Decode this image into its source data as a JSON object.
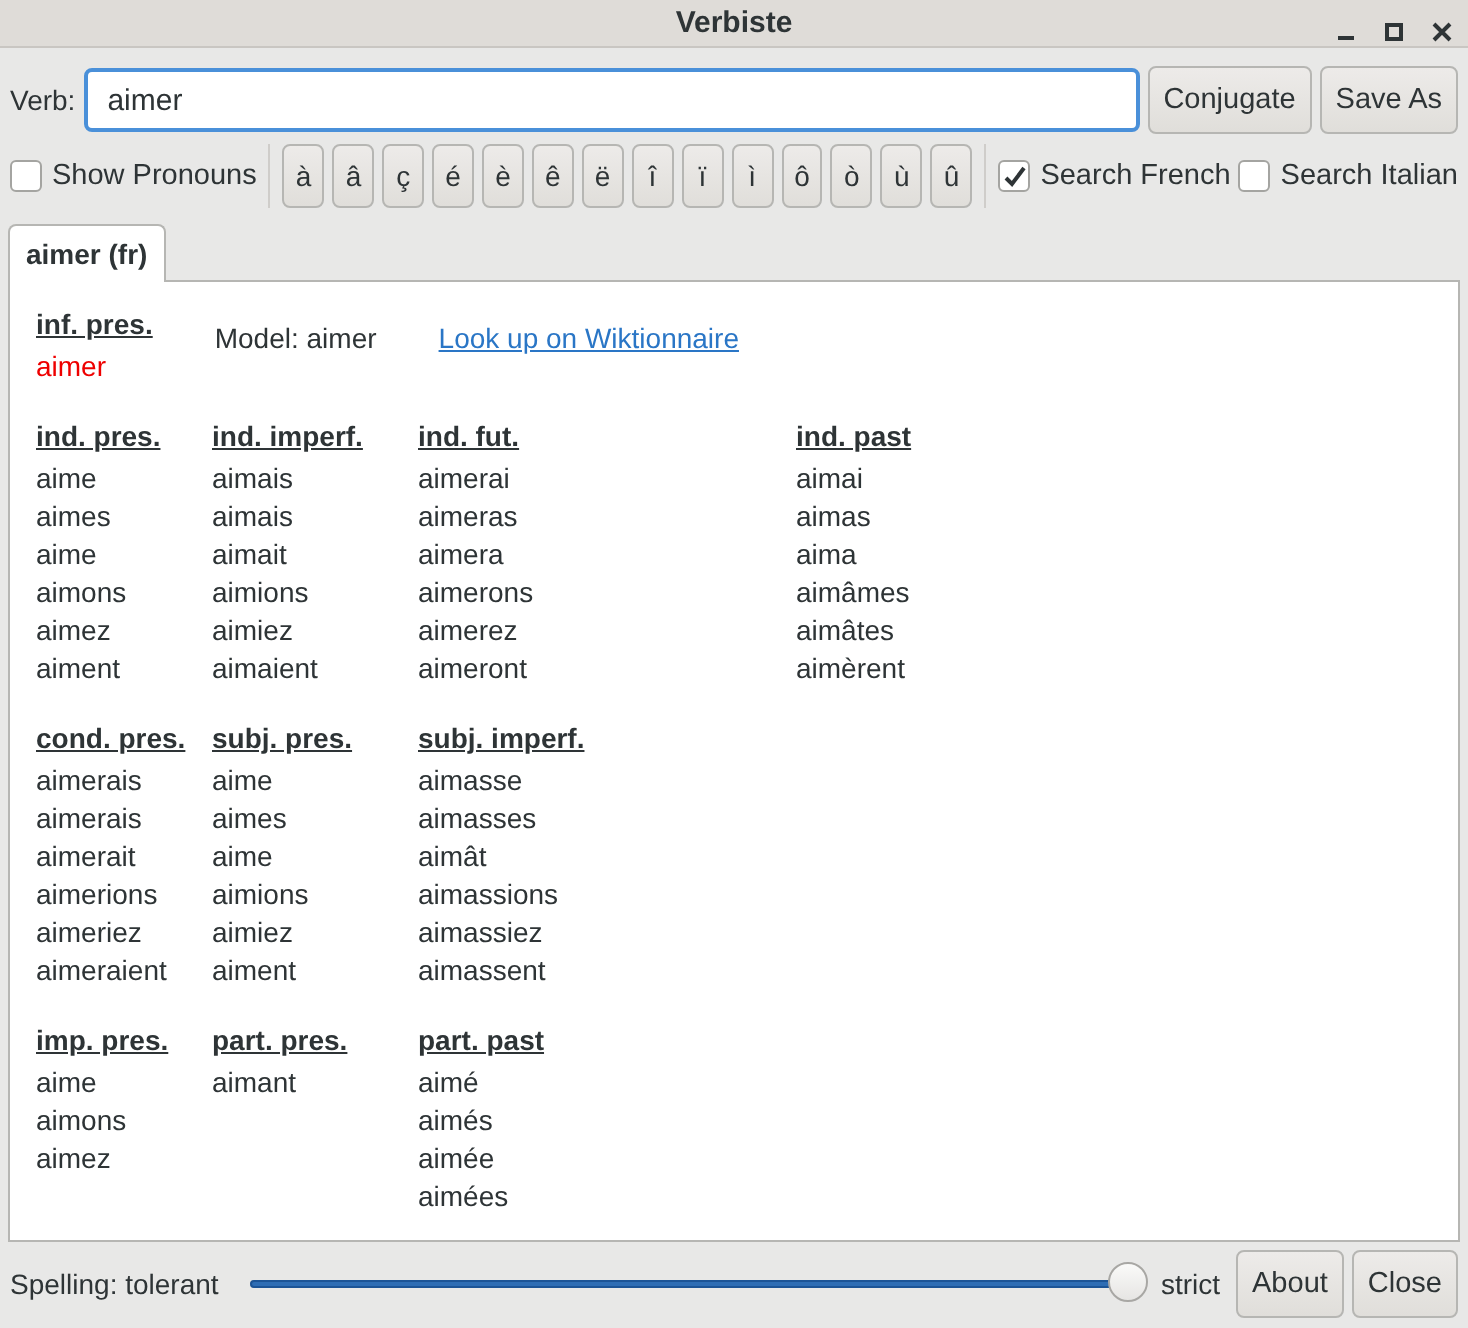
{
  "window": {
    "title": "Verbiste"
  },
  "verb_field": {
    "label": "Verb:",
    "value": "aimer"
  },
  "buttons_top": [
    "Conjugate",
    "Save As"
  ],
  "show_pronouns": {
    "label": "Show Pronouns",
    "checked": false
  },
  "accent_keys": [
    "à",
    "â",
    "ç",
    "é",
    "è",
    "ê",
    "ë",
    "î",
    "ï",
    "ì",
    "ô",
    "ò",
    "ù",
    "û"
  ],
  "search_options": [
    {
      "label": "Search French",
      "checked": true
    },
    {
      "label": "Search Italian",
      "checked": false
    }
  ],
  "tabs": [
    {
      "label": "aimer (fr)",
      "selected": true
    }
  ],
  "infinitive": {
    "heading": "inf. pres.",
    "form": "aimer",
    "model": "Model: aimer",
    "link": "Look up on Wiktionnaire"
  },
  "tense_rows": [
    [
      {
        "heading": "ind. pres.",
        "forms": [
          "aime",
          "aimes",
          "aime",
          "aimons",
          "aimez",
          "aiment"
        ]
      },
      {
        "heading": "ind. imperf.",
        "forms": [
          "aimais",
          "aimais",
          "aimait",
          "aimions",
          "aimiez",
          "aimaient"
        ]
      },
      {
        "heading": "ind. fut.",
        "forms": [
          "aimerai",
          "aimeras",
          "aimera",
          "aimerons",
          "aimerez",
          "aimeront"
        ]
      },
      {
        "heading": "ind. past",
        "forms": [
          "aimai",
          "aimas",
          "aima",
          "aimâmes",
          "aimâtes",
          "aimèrent"
        ]
      }
    ],
    [
      {
        "heading": "cond. pres.",
        "forms": [
          "aimerais",
          "aimerais",
          "aimerait",
          "aimerions",
          "aimeriez",
          "aimeraient"
        ]
      },
      {
        "heading": "subj. pres.",
        "forms": [
          "aime",
          "aimes",
          "aime",
          "aimions",
          "aimiez",
          "aiment"
        ]
      },
      {
        "heading": "subj. imperf.",
        "forms": [
          "aimasse",
          "aimasses",
          "aimât",
          "aimassions",
          "aimassiez",
          "aimassent"
        ]
      }
    ],
    [
      {
        "heading": "imp. pres.",
        "forms": [
          "aime",
          "aimons",
          "aimez"
        ]
      },
      {
        "heading": "part. pres.",
        "forms": [
          "aimant"
        ]
      },
      {
        "heading": "part. past",
        "forms": [
          "aimé",
          "aimés",
          "aimée",
          "aimées"
        ]
      }
    ]
  ],
  "spelling": {
    "label": "Spelling: tolerant",
    "end_label": "strict",
    "level": 1
  },
  "buttons_bottom": [
    "About",
    "Close"
  ]
}
